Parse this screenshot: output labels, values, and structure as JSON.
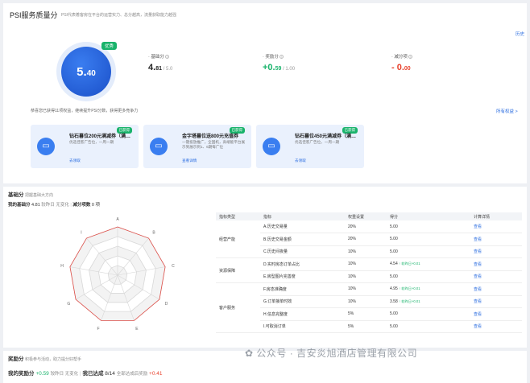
{
  "header": {
    "title": "PSI服务质量分",
    "subtitle": "PSI代表着客房在平台的运营实力、总分越高，流量获取能力越强",
    "right_link": "历史"
  },
  "score": {
    "whole": "5.",
    "decimal": "40",
    "badge": "优秀"
  },
  "metrics": [
    {
      "label": "基础分",
      "whole": "4.",
      "decimal": "81",
      "total": " / 5.0",
      "color": "#222"
    },
    {
      "label": "奖励分",
      "whole": "+0.",
      "decimal": "59",
      "total": " / 1.00",
      "color": "#19b36b"
    },
    {
      "label": "减分项",
      "whole": "- 0.",
      "decimal": "00",
      "total": "",
      "color": "#e8412c"
    }
  ],
  "tip": {
    "text": "恭喜您已获得11项权益，继续提升PSI分数，获得更多竞争力",
    "link": "所有权益 >"
  },
  "coupons": [
    {
      "tag": "已获得",
      "title": "钻石暮位200元满减券（满…",
      "desc": "优选佳客广告位，一周一期",
      "action": "去领取"
    },
    {
      "tag": "已获得",
      "title": "金字塔暮位送800元充值券",
      "desc": "一键投放推广，全国机，高端能平台展示到展示到1、6期每广位",
      "action": "查看详情"
    },
    {
      "tag": "已获得",
      "title": "钻石暮位450元满减券（满…",
      "desc": "优选佳客广告位，一周一期",
      "action": "去领取"
    }
  ],
  "base": {
    "title": "基础分",
    "desc": "把握基础大方向",
    "my_label": "我的基础分",
    "my_value": "4.81",
    "compare": "较昨日 无变化",
    "deduct_label": "减分项数",
    "deduct_value": "0 项"
  },
  "radar": {
    "labels": [
      "A",
      "B",
      "C",
      "D",
      "E",
      "F",
      "G",
      "H",
      "I"
    ]
  },
  "table": {
    "headers": [
      "指标类型",
      "指标",
      "权重设置",
      "得分",
      "计算详情"
    ],
    "groups": [
      {
        "category": "经营产能",
        "rows": [
          {
            "name": "A.历史交易量",
            "weight": "20%",
            "score": "5.00",
            "change": "",
            "link": "查看"
          },
          {
            "name": "B.历史交易金额",
            "weight": "20%",
            "score": "5.00",
            "change": "",
            "link": "查看"
          },
          {
            "name": "C.历史间夜量",
            "weight": "10%",
            "score": "5.00",
            "change": "",
            "link": "查看"
          }
        ]
      },
      {
        "category": "资源保障",
        "rows": [
          {
            "name": "D.实时房态订单占比",
            "weight": "10%",
            "score": "4.54",
            "change": "↑ 较昨日+0.01",
            "link": "查看"
          },
          {
            "name": "E.房型图片完善度",
            "weight": "10%",
            "score": "5.00",
            "change": "",
            "link": "查看"
          }
        ]
      },
      {
        "category": "客户服务",
        "rows": [
          {
            "name": "F.房态准确度",
            "weight": "10%",
            "score": "4.95",
            "change": "↑ 较昨日+0.01",
            "link": "查看"
          },
          {
            "name": "G.订单接单时效",
            "weight": "10%",
            "score": "3.58",
            "change": "↑ 较昨日+0.01",
            "link": "查看"
          },
          {
            "name": "H.信息完整度",
            "weight": "5%",
            "score": "5.00",
            "change": "",
            "link": "查看"
          },
          {
            "name": "I.可取消订单",
            "weight": "5%",
            "score": "5.00",
            "change": "",
            "link": "查看"
          }
        ]
      }
    ]
  },
  "reward": {
    "title": "奖励分",
    "desc": "积极参与活动，助力提分好帮手",
    "my_label": "我的奖励分",
    "my_value": "+0.59",
    "compare": "较昨日 无变化",
    "done_label": "我已达成",
    "done_value": "8/14",
    "all_label": "全部达成后奖励",
    "all_value": "+0.41"
  },
  "watermark": "公众号 · 吉安炎旭酒店管理有限公司"
}
